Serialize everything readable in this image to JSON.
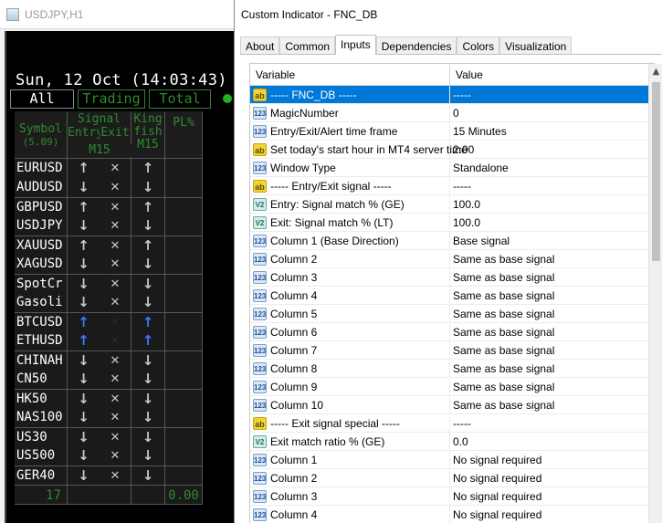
{
  "chart_window": {
    "title": "USDJPY,H1",
    "clock": "Sun, 12 Oct (14:03:43) 1",
    "filters": [
      "All",
      "Trading",
      "Total"
    ],
    "header": {
      "symbol": "Symbol",
      "symbol_sub": "(5.09)",
      "signal": "Signal",
      "entry": "Entry",
      "exit": "Exit",
      "timeframe": "M15",
      "king": "King",
      "fish": "fish",
      "king_tf": "M15",
      "pl": "PL%"
    },
    "rows": [
      {
        "symbol": "EURUSD",
        "entry": "↑",
        "exit": "✕",
        "king": "↑",
        "style": "normal"
      },
      {
        "symbol": "AUDUSD",
        "entry": "↓",
        "exit": "✕",
        "king": "↓",
        "style": "normal"
      },
      {
        "symbol": "GBPUSD",
        "entry": "↑",
        "exit": "✕",
        "king": "↑",
        "style": "normal"
      },
      {
        "symbol": "USDJPY",
        "entry": "↓",
        "exit": "✕",
        "king": "↓",
        "style": "normal"
      },
      {
        "symbol": "XAUUSD",
        "entry": "↑",
        "exit": "✕",
        "king": "↑",
        "style": "normal"
      },
      {
        "symbol": "XAGUSD",
        "entry": "↓",
        "exit": "✕",
        "king": "↓",
        "style": "normal"
      },
      {
        "symbol": "SpotCr",
        "entry": "↓",
        "exit": "✕",
        "king": "↓",
        "style": "normal"
      },
      {
        "symbol": "Gasoli",
        "entry": "↓",
        "exit": "✕",
        "king": "↓",
        "style": "normal"
      },
      {
        "symbol": "BTCUSD",
        "entry": "↑",
        "exit": "✕",
        "king": "↑",
        "style": "blue"
      },
      {
        "symbol": "ETHUSD",
        "entry": "↑",
        "exit": "✕",
        "king": "↑",
        "style": "blue"
      },
      {
        "symbol": "CHINAH",
        "entry": "↓",
        "exit": "✕",
        "king": "↓",
        "style": "normal"
      },
      {
        "symbol": "CN50",
        "entry": "↓",
        "exit": "✕",
        "king": "↓",
        "style": "normal"
      },
      {
        "symbol": "HK50",
        "entry": "↓",
        "exit": "✕",
        "king": "↓",
        "style": "normal"
      },
      {
        "symbol": "NAS100",
        "entry": "↓",
        "exit": "✕",
        "king": "↓",
        "style": "normal"
      },
      {
        "symbol": "US30",
        "entry": "↓",
        "exit": "✕",
        "king": "↓",
        "style": "normal"
      },
      {
        "symbol": "US500",
        "entry": "↓",
        "exit": "✕",
        "king": "↓",
        "style": "normal"
      },
      {
        "symbol": "GER40",
        "entry": "↓",
        "exit": "✕",
        "king": "↓",
        "style": "normal"
      }
    ],
    "footer": {
      "count": "17",
      "pl": "0.00"
    },
    "colors": {
      "green": "#2e8b2e",
      "blue_arrow": "#3f7bff",
      "background": "#000000"
    }
  },
  "dialog": {
    "title": "Custom Indicator - FNC_DB",
    "tabs": [
      "About",
      "Common",
      "Inputs",
      "Dependencies",
      "Colors",
      "Visualization"
    ],
    "active_tab": "Inputs",
    "columns": {
      "variable": "Variable",
      "value": "Value"
    },
    "params": [
      {
        "type": "ab",
        "name": "----- FNC_DB -----",
        "value": "-----",
        "selected": true
      },
      {
        "type": "123",
        "name": "MagicNumber",
        "value": "0"
      },
      {
        "type": "123",
        "name": "Entry/Exit/Alert time frame",
        "value": "15 Minutes"
      },
      {
        "type": "ab",
        "name": "Set today's start hour in MT4 server time",
        "value": "2:00"
      },
      {
        "type": "123",
        "name": "Window Type",
        "value": "Standalone"
      },
      {
        "type": "ab",
        "name": "----- Entry/Exit signal -----",
        "value": "-----"
      },
      {
        "type": "dbl",
        "name": "Entry: Signal match % (GE)",
        "value": "100.0"
      },
      {
        "type": "dbl",
        "name": "Exit: Signal match % (LT)",
        "value": "100.0"
      },
      {
        "type": "123",
        "name": "Column 1 (Base Direction)",
        "value": "Base signal"
      },
      {
        "type": "123",
        "name": "Column 2",
        "value": "Same as base signal"
      },
      {
        "type": "123",
        "name": "Column 3",
        "value": "Same as base signal"
      },
      {
        "type": "123",
        "name": "Column 4",
        "value": "Same as base signal"
      },
      {
        "type": "123",
        "name": "Column 5",
        "value": "Same as base signal"
      },
      {
        "type": "123",
        "name": "Column 6",
        "value": "Same as base signal"
      },
      {
        "type": "123",
        "name": "Column 7",
        "value": "Same as base signal"
      },
      {
        "type": "123",
        "name": "Column 8",
        "value": "Same as base signal"
      },
      {
        "type": "123",
        "name": "Column 9",
        "value": "Same as base signal"
      },
      {
        "type": "123",
        "name": "Column 10",
        "value": "Same as base signal"
      },
      {
        "type": "ab",
        "name": "----- Exit signal special -----",
        "value": "-----"
      },
      {
        "type": "dbl",
        "name": "Exit match ratio % (GE)",
        "value": "0.0"
      },
      {
        "type": "123",
        "name": "Column 1",
        "value": "No signal required"
      },
      {
        "type": "123",
        "name": "Column 2",
        "value": "No signal required"
      },
      {
        "type": "123",
        "name": "Column 3",
        "value": "No signal required"
      },
      {
        "type": "123",
        "name": "Column 4",
        "value": "No signal required"
      }
    ],
    "icon_labels": {
      "ab": "ab",
      "123": "123",
      "dbl": "V2"
    }
  }
}
